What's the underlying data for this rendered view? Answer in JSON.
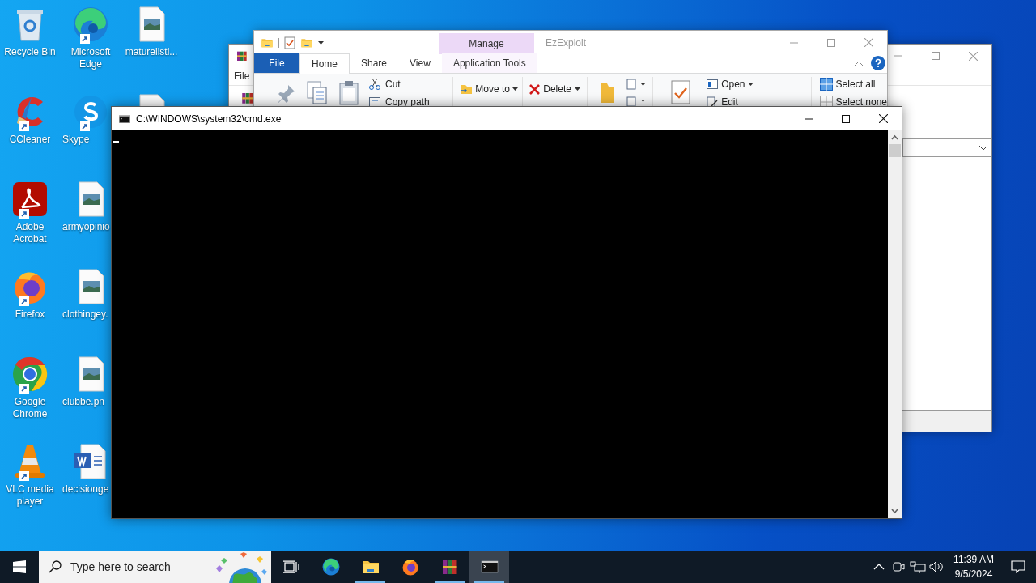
{
  "desktop_icons": [
    {
      "label": "Recycle Bin",
      "kind": "recycle",
      "shortcut": false
    },
    {
      "label": "Microsoft Edge",
      "kind": "edge",
      "shortcut": true
    },
    {
      "label": "maturelisti...",
      "kind": "image",
      "shortcut": false
    },
    {
      "label": "CCleaner",
      "kind": "ccleaner",
      "shortcut": true
    },
    {
      "label": "Skype",
      "kind": "skype",
      "shortcut": true
    },
    {
      "kind": "image"
    },
    {
      "label": "Adobe Acrobat",
      "kind": "acrobat",
      "shortcut": true
    },
    {
      "label": "armyopinio",
      "kind": "image",
      "shortcut": false
    },
    {
      "label": "Firefox",
      "kind": "firefox",
      "shortcut": true
    },
    {
      "label": "clothingey.",
      "kind": "image",
      "shortcut": false
    },
    {
      "label": "Google Chrome",
      "kind": "chrome",
      "shortcut": true
    },
    {
      "label": "clubbe.pn",
      "kind": "image",
      "shortcut": false
    },
    {
      "label": "VLC media player",
      "kind": "vlc",
      "shortcut": true
    },
    {
      "label": "decisionge",
      "kind": "word",
      "shortcut": false
    }
  ],
  "back_window": {
    "menu": "File"
  },
  "explorer": {
    "title": "EzExploit",
    "context_group": "Manage",
    "tabs": [
      {
        "label": "File",
        "kind": "file",
        "selected": false
      },
      {
        "label": "Home",
        "kind": "tab",
        "selected": true
      },
      {
        "label": "Share",
        "kind": "tab",
        "selected": false
      },
      {
        "label": "View",
        "kind": "tab",
        "selected": false
      },
      {
        "label": "Application Tools",
        "kind": "context",
        "selected": false
      }
    ],
    "ribbon": {
      "cut": "Cut",
      "copy_path": "Copy path",
      "move_to": "Move to",
      "delete": "Delete",
      "open": "Open",
      "edit": "Edit",
      "select_all": "Select all",
      "select_none": "Select none"
    }
  },
  "cmd": {
    "title": "C:\\WINDOWS\\system32\\cmd.exe"
  },
  "taskbar": {
    "search_placeholder": "Type here to search",
    "apps": [
      {
        "kind": "taskview",
        "running": false,
        "selected": false
      },
      {
        "kind": "edge",
        "running": false,
        "selected": false
      },
      {
        "kind": "explorer",
        "running": true,
        "selected": false
      },
      {
        "kind": "firefox",
        "running": false,
        "selected": false
      },
      {
        "kind": "winrar",
        "running": true,
        "selected": false
      },
      {
        "kind": "cmd",
        "running": true,
        "selected": true
      }
    ],
    "time": "11:39 AM",
    "date": "9/5/2024"
  }
}
